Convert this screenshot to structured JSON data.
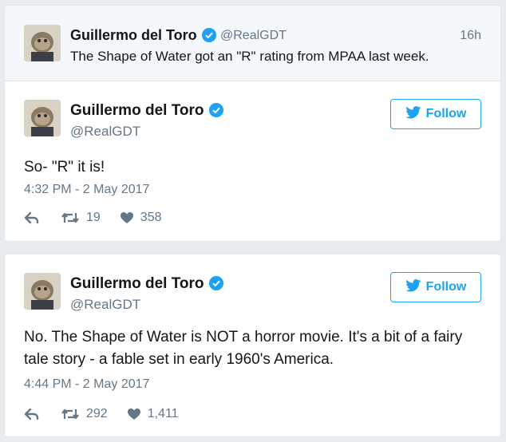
{
  "parent": {
    "name": "Guillermo del Toro",
    "handle": "@RealGDT",
    "time": "16h",
    "text": "The Shape of Water got an \"R\" rating from MPAA last week."
  },
  "tweets": [
    {
      "name": "Guillermo del Toro",
      "handle": "@RealGDT",
      "follow_label": "Follow",
      "text": "So- \"R\" it is!",
      "timestamp": "4:32 PM - 2 May 2017",
      "retweets": "19",
      "likes": "358"
    },
    {
      "name": "Guillermo del Toro",
      "handle": "@RealGDT",
      "follow_label": "Follow",
      "text": "No. The Shape of Water is NOT a horror movie. It's a bit of a fairy tale story - a fable set in early 1960's America.",
      "timestamp": "4:44 PM - 2 May 2017",
      "retweets": "292",
      "likes": "1,411"
    }
  ],
  "colors": {
    "accent": "#1da1f2",
    "muted": "#657786",
    "text": "#14171a"
  },
  "icons": [
    "verified-icon",
    "twitter-bird-icon",
    "reply-icon",
    "retweet-icon",
    "heart-icon"
  ]
}
